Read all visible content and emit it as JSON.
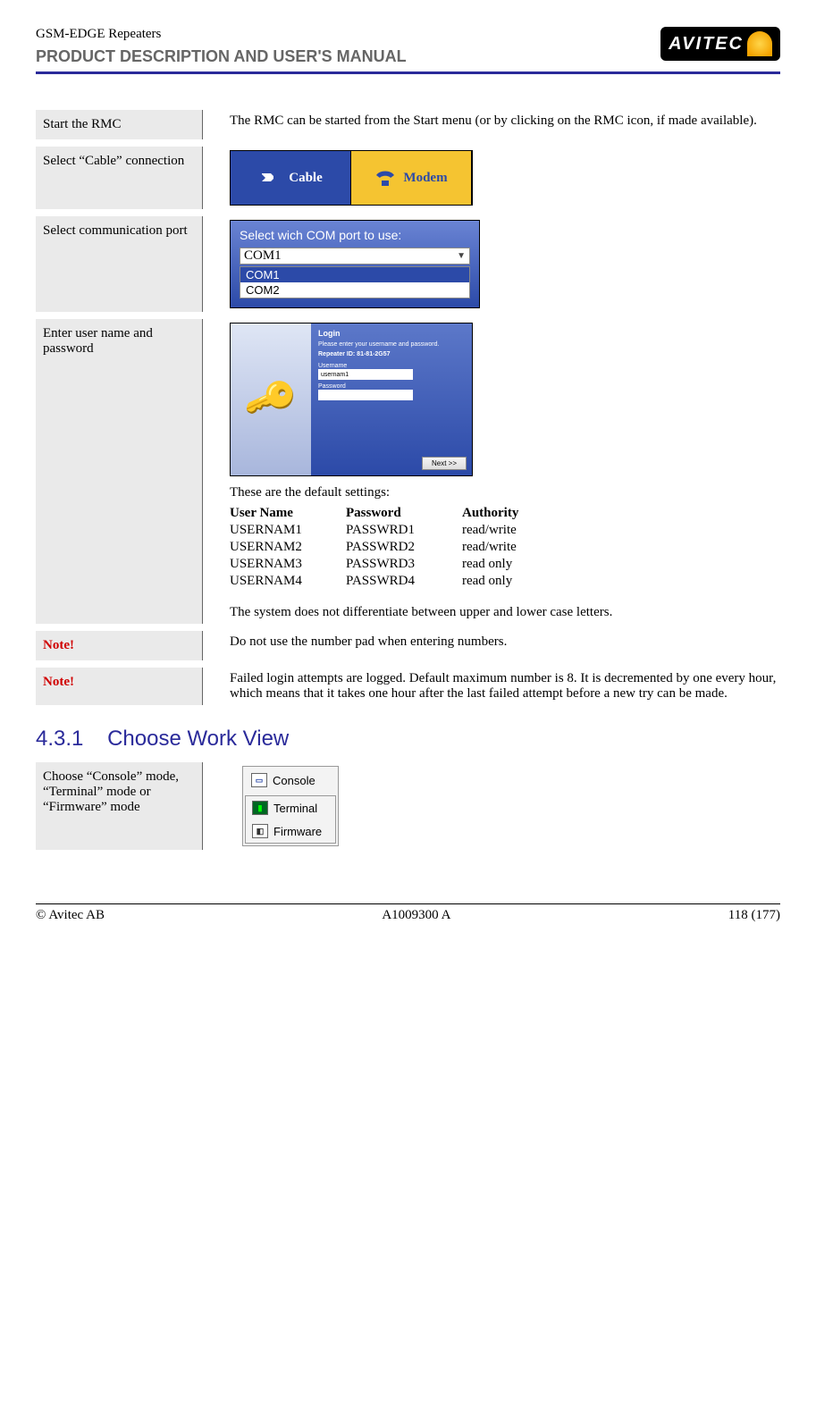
{
  "header": {
    "doc_line": "GSM-EDGE Repeaters",
    "manual_title": "PRODUCT DESCRIPTION AND USER'S MANUAL",
    "logo_text": "AVITEC"
  },
  "rows": {
    "start_rmc": {
      "label": "Start the RMC",
      "text": "The RMC can be started from the Start menu (or by clicking on the RMC icon, if made available)."
    },
    "cable": {
      "label": "Select “Cable” connection",
      "btn_cable": "Cable",
      "btn_modem": "Modem"
    },
    "comport": {
      "label": "Select communication port",
      "title": "Select wich COM port to use:",
      "field": "COM1",
      "opt_sel": "COM1",
      "opt2": "COM2"
    },
    "login": {
      "label": "Enter user name and password",
      "title": "Login",
      "subtitle": "Please enter your username and password.",
      "repeater": "Repeater ID: 81-81-2G57",
      "user_label": "Username",
      "user_value": "usernam1",
      "pass_label": "Password",
      "next": "Next >>",
      "defaults_intro": "These are the default settings:",
      "headers": {
        "u": "User Name",
        "p": "Password",
        "a": "Authority"
      },
      "rowsd": [
        {
          "u": "USERNAM1",
          "p": "PASSWRD1",
          "a": "read/write"
        },
        {
          "u": "USERNAM2",
          "p": "PASSWRD2",
          "a": "read/write"
        },
        {
          "u": "USERNAM3",
          "p": "PASSWRD3",
          "a": "read only"
        },
        {
          "u": "USERNAM4",
          "p": "PASSWRD4",
          "a": "read only"
        }
      ],
      "case_note": "The system does not differentiate between upper and lower case letters."
    },
    "note1": {
      "label": "Note!",
      "text": "Do not use the number pad when entering numbers."
    },
    "note2": {
      "label": "Note!",
      "text": "Failed login attempts are logged. Default maximum number is 8. It is decremented by one every hour, which means that it takes one hour after the last failed attempt before a new try can be made."
    }
  },
  "section": {
    "number": "4.3.1",
    "title": "Choose Work View"
  },
  "workview": {
    "label": "Choose “Console” mode, “Terminal” mode or “Firmware” mode",
    "console": "Console",
    "terminal": "Terminal",
    "firmware": "Firmware"
  },
  "footer": {
    "left": "© Avitec AB",
    "center": "A1009300 A",
    "right": "118 (177)"
  }
}
